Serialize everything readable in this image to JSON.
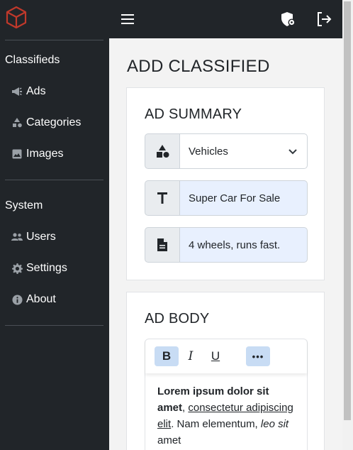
{
  "sidebar": {
    "sections": [
      {
        "label": "Classifieds",
        "items": [
          {
            "label": "Ads",
            "icon": "megaphone-icon"
          },
          {
            "label": "Categories",
            "icon": "shapes-icon"
          },
          {
            "label": "Images",
            "icon": "image-icon"
          }
        ]
      },
      {
        "label": "System",
        "items": [
          {
            "label": "Users",
            "icon": "users-icon"
          },
          {
            "label": "Settings",
            "icon": "gear-icon"
          },
          {
            "label": "About",
            "icon": "info-icon"
          }
        ]
      }
    ]
  },
  "page": {
    "title": "ADD CLASSIFIED"
  },
  "summary": {
    "title": "AD SUMMARY",
    "category_value": "Vehicles",
    "title_value": "Super Car For Sale",
    "description_value": "4 wheels, runs fast."
  },
  "body": {
    "title": "AD BODY",
    "toolbar": {
      "bold": "B",
      "italic": "I",
      "underline": "U",
      "more": "•••"
    },
    "text": {
      "bold_part": "Lorem ipsum dolor sit amet",
      "comma": ", ",
      "underline_part": "consectetur adipiscing elit",
      "mid": ". Nam elementum, ",
      "italic_part": "leo sit",
      "end": " amet"
    }
  },
  "colors": {
    "sidebar_bg": "#212529",
    "accent_logo": "#c0392b",
    "active_tool": "#c8dcf4",
    "filled_field": "#e8f0fe"
  }
}
